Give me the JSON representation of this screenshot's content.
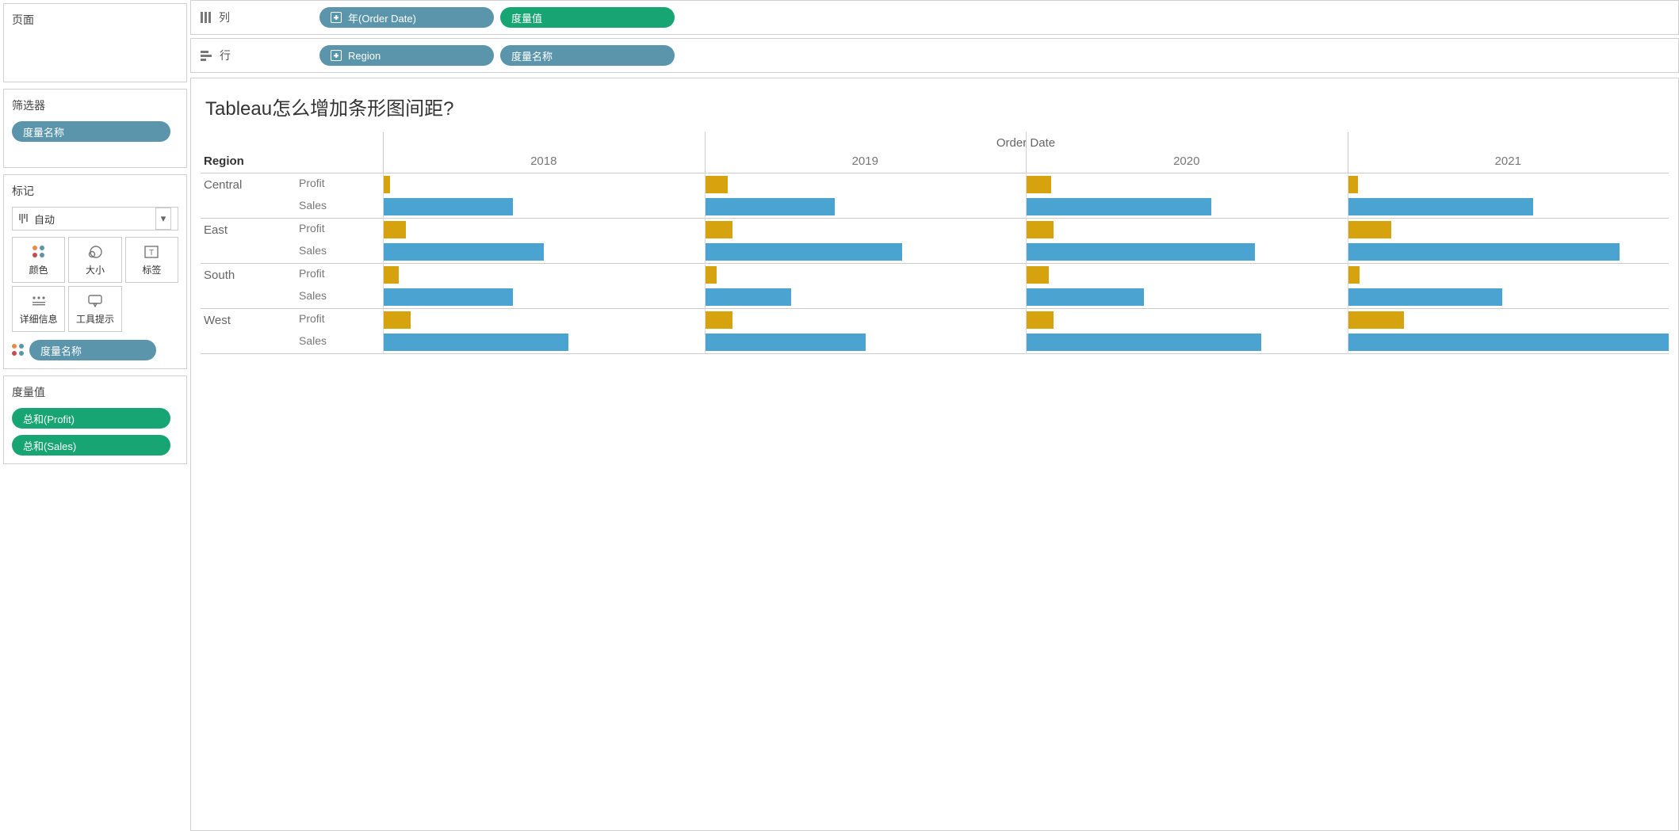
{
  "sidebar": {
    "pages": {
      "title": "页面"
    },
    "filters": {
      "title": "筛选器",
      "pill": "度量名称"
    },
    "marks": {
      "title": "标记",
      "dropdown": "自动",
      "cells": {
        "color": "颜色",
        "size": "大小",
        "label": "标签",
        "detail": "详细信息",
        "tooltip": "工具提示"
      },
      "color_pill": "度量名称"
    },
    "measure_values": {
      "title": "度量值",
      "items": [
        "总和(Profit)",
        "总和(Sales)"
      ]
    }
  },
  "shelves": {
    "columns": {
      "label": "列",
      "pills": [
        {
          "text": "年(Order Date)",
          "color": "blue",
          "expand": true
        },
        {
          "text": "度量值",
          "color": "green",
          "expand": false
        }
      ]
    },
    "rows": {
      "label": "行",
      "pills": [
        {
          "text": "Region",
          "color": "blue",
          "expand": true
        },
        {
          "text": "度量名称",
          "color": "blue",
          "expand": false
        }
      ]
    }
  },
  "viz": {
    "title": "Tableau怎么增加条形图间距?",
    "super_header": "Order Date",
    "region_header": "Region"
  },
  "colors": {
    "profit": "#d6a20d",
    "sales": "#4aa3d1"
  },
  "chart_data": {
    "type": "bar",
    "title": "Tableau怎么增加条形图间距?",
    "super_header": "Order Date",
    "x_categories": [
      "2018",
      "2019",
      "2020",
      "2021"
    ],
    "row_groups": [
      "Central",
      "East",
      "South",
      "West"
    ],
    "measures": [
      "Profit",
      "Sales"
    ],
    "xlim_per_cell": [
      0,
      260000
    ],
    "series": {
      "Central": {
        "Profit": [
          5000,
          18000,
          20000,
          8000
        ],
        "Sales": [
          105000,
          105000,
          150000,
          150000
        ]
      },
      "East": {
        "Profit": [
          18000,
          22000,
          22000,
          35000
        ],
        "Sales": [
          130000,
          160000,
          185000,
          220000
        ]
      },
      "South": {
        "Profit": [
          12000,
          9000,
          18000,
          9000
        ],
        "Sales": [
          105000,
          70000,
          95000,
          125000
        ]
      },
      "West": {
        "Profit": [
          22000,
          22000,
          22000,
          45000
        ],
        "Sales": [
          150000,
          130000,
          190000,
          260000
        ]
      }
    }
  }
}
